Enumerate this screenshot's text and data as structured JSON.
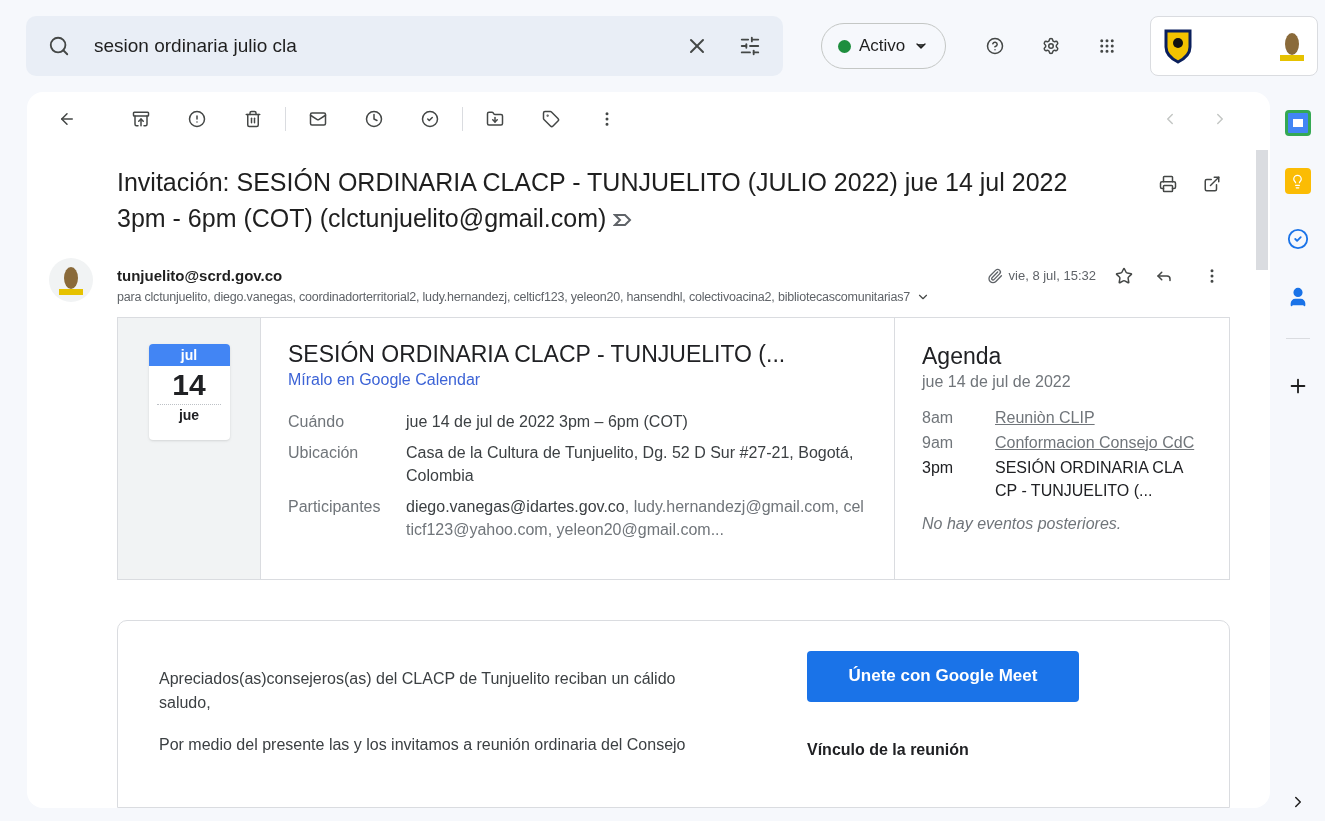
{
  "search": {
    "value": "sesion ordinaria julio cla"
  },
  "status": {
    "label": "Activo",
    "color": "#1e8e3e"
  },
  "subject": {
    "text": "Invitación: SESIÓN ORDINARIA CLACP - TUNJUELITO (JULIO 2022) jue 14 jul 2022 3pm - 6pm (COT) (clctunjuelito@gmail.com)"
  },
  "message": {
    "sender": "tunjuelito@scrd.gov.co",
    "date": "vie, 8 jul, 15:32",
    "has_attachment": true,
    "recipients": "para clctunjuelito, diego.vanegas, coordinadorterritorial2, ludy.hernandezj, celticf123, yeleon20, hansendhl, colectivoacina2, bibliotecascomunitarias7"
  },
  "invite": {
    "month": "jul",
    "day": "14",
    "weekday": "jue",
    "title": "SESIÓN ORDINARIA CLACP - TUNJUELITO (...",
    "link": "Míralo en Google Calendar",
    "details": [
      {
        "label": "Cuándo",
        "value": "jue 14 de jul de 2022 3pm – 6pm (COT)"
      },
      {
        "label": "Ubicación",
        "value": "Casa de la Cultura de Tunjuelito, Dg. 52 D Sur #27-21, Bogotá, Colombia"
      },
      {
        "label": "Participantes",
        "value": "diego.vanegas@idartes.gov.co",
        "more": ", ludy.hernandezj@gmail.com, celticf123@yahoo.com, yeleon20@gmail.com..."
      }
    ]
  },
  "agenda": {
    "title": "Agenda",
    "date": "jue 14 de jul de 2022",
    "events": [
      {
        "time": "8am",
        "title": "Reuniòn CLIP",
        "kind": "other"
      },
      {
        "time": "9am",
        "title": "Conformacion Consejo CdC",
        "kind": "other"
      },
      {
        "time": "3pm",
        "title": "SESIÓN ORDINARIA CLACP - TUNJUELITO (...",
        "kind": "current"
      }
    ],
    "footer": "No hay eventos posteriores."
  },
  "body": {
    "paragraphs": [
      "Apreciados(as)consejeros(as) del CLACP de Tunjuelito reciban un cálido saludo,",
      "Por medio del presente las y los invitamos a reunión ordinaria del Consejo"
    ],
    "meet_button": "Únete con Google Meet",
    "link_heading": "Vínculo de la reunión"
  }
}
